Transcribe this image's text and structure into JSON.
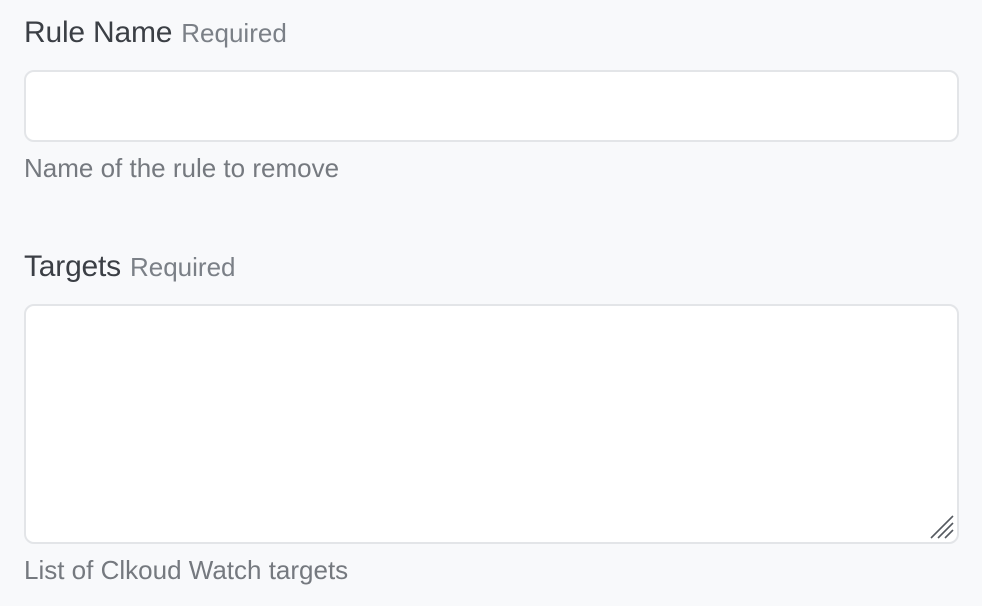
{
  "rule_name": {
    "label": "Rule Name",
    "required": "Required",
    "value": "",
    "help": "Name of the rule to remove"
  },
  "targets": {
    "label": "Targets",
    "required": "Required",
    "value": "",
    "help": "List of Clkoud Watch targets"
  },
  "icons": {
    "resize_handle": "resize-grip-icon"
  }
}
